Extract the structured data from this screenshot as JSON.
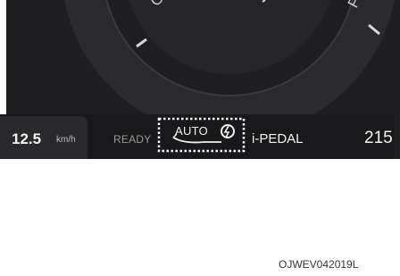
{
  "gauge": {
    "left_label": "GE",
    "right_label": "PO"
  },
  "status_bar": {
    "speed_value": "12.5",
    "speed_unit": "km/h",
    "ready_label": "READY",
    "auto_label": "AUTO",
    "ipedal_label": "i-PEDAL",
    "range_value": "215"
  },
  "figure": {
    "caption": "OJWEV042019L"
  },
  "colors": {
    "display_background": "#1f1f21",
    "highlight_border": "#ffffff",
    "text_primary": "#f2f2f2",
    "text_dim": "#9a9a9a"
  },
  "icons": [
    "regen-level-icon",
    "dotted-highlight-box"
  ]
}
